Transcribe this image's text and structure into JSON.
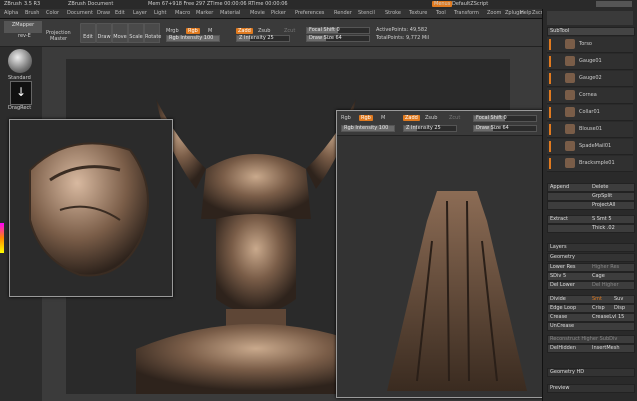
{
  "app": {
    "title": "ZBrush",
    "version": "3.5 R3",
    "document": "ZBrush Document",
    "stats": "Mem 67+918  Free 297  ZTime 00:00:06  RTime 00:00:06",
    "menus_button": "Menus",
    "script_label": "DefaultZScript"
  },
  "menu": [
    "Alpha",
    "Brush",
    "Color",
    "Document",
    "Draw",
    "Edit",
    "Layer",
    "Light",
    "Macro",
    "Marker",
    "Material",
    "Movie",
    "Picker",
    "Preferences",
    "Render",
    "Stencil",
    "Stroke",
    "Texture",
    "Tool",
    "Transform",
    "Zoom",
    "Zplugin",
    "Zscript"
  ],
  "right_menu": [
    "Help"
  ],
  "toolbar": {
    "zmapper": "ZMapper",
    "zmapper_sub": "rev-E",
    "projection": "Projection",
    "master": "Master",
    "edit": "Edit",
    "draw": "Draw",
    "move": "Move",
    "scale": "Scale",
    "rotate": "Rotate",
    "mrgb": "Mrgb",
    "rgb": "Rgb",
    "m": "M",
    "zadd": "Zadd",
    "zsub": "Zsub",
    "zcut": "Zcut",
    "rgb_intensity": "Rgb Intensity 100",
    "z_intensity": "Z Intensity 25",
    "focal_shift": "Focal Shift 0",
    "draw_size": "Draw Size 64",
    "active_points": "ActivePoints: 49,582",
    "total_points": "TotalPoints: 9,772 Mil"
  },
  "left_tray": {
    "standard": "Standard",
    "dragrect": "DragRect"
  },
  "inset2": {
    "rgb": "Rgb",
    "m": "M",
    "zadd": "Zadd",
    "zsub": "Zsub",
    "zcut": "Zcut",
    "rgb_intensity": "Rgb Intensity 100",
    "z_intensity": "Z Intensity 25",
    "focal_shift": "Focal Shift 0",
    "draw_size": "Draw Size 64"
  },
  "right_tray": {
    "subtool": "SubTool",
    "subtools": [
      "Torso",
      "Gauge01",
      "Gauge02",
      "Cornea",
      "Collar01",
      "Blouse01",
      "SpadeMail01",
      "Bracksmple01"
    ],
    "append": "Append",
    "delete": "Delete",
    "grpsplit": "GrpSplit",
    "projectall": "ProjectAll",
    "extract": "Extract",
    "smt": "S Smt 5",
    "thick": "Thick .02",
    "layers": "Layers",
    "geometry": "Geometry",
    "lower_res": "Lower Res",
    "higher_res": "Higher Res",
    "sdiv": "SDiv 5",
    "cage": "Cage",
    "del_lower": "Del Lower",
    "del_higher": "Del Higher",
    "divide": "Divide",
    "smt2": "Smt",
    "suv": "Suv",
    "edge_loop": "Edge Loop",
    "crisp": "Crisp",
    "disp": "Disp",
    "crease": "Crease",
    "creaselvl": "CreaseLvl 15",
    "uncrease": "UnCrease",
    "reconstruct": "Reconstruct Higher SubDiv",
    "delhidden": "DelHidden",
    "insertmesh": "InsertMesh",
    "geometry_hd": "Geometry HD",
    "preview": "Preview"
  },
  "colors": {
    "accent": "#e07a1f",
    "bg": "#3b3b3b",
    "panel": "#2a2a2a"
  }
}
